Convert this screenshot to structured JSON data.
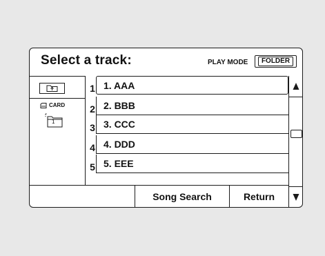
{
  "header": {
    "title": "Select a track:",
    "play_mode_label": "PLAY MODE",
    "folder_button_label": "FOLDER"
  },
  "folder_panel": {
    "card_label": "CARD",
    "folder_number": "1"
  },
  "tracks": [
    {
      "number": "1",
      "label": "1. AAA",
      "selected": true
    },
    {
      "number": "2",
      "label": "2. BBB",
      "selected": false
    },
    {
      "number": "3",
      "label": "3. CCC",
      "selected": false
    },
    {
      "number": "4",
      "label": "4. DDD",
      "selected": false
    },
    {
      "number": "5",
      "label": "5. EEE",
      "selected": false
    }
  ],
  "footer": {
    "song_search_label": "Song Search",
    "return_label": "Return"
  },
  "icons": {
    "up_folder": "folder-up-icon",
    "card": "card-icon",
    "folder": "folder-icon",
    "scroll_up": "triangle-up-icon",
    "scroll_down": "triangle-down-icon"
  }
}
